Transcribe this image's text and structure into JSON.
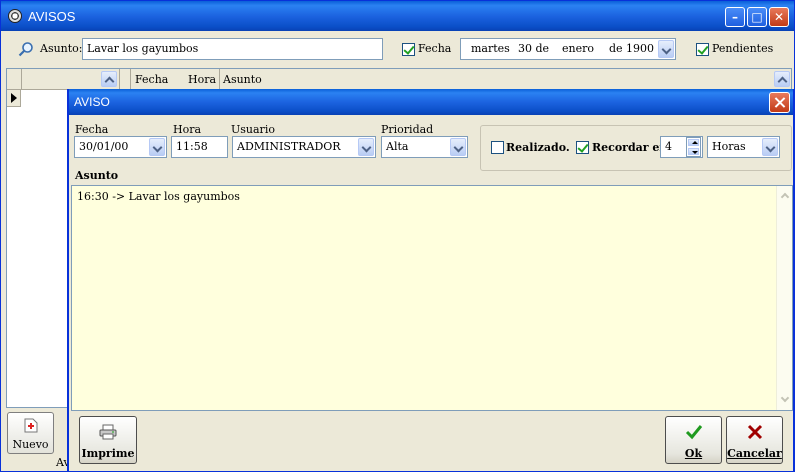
{
  "window": {
    "title": "AVISOS"
  },
  "search": {
    "label": "Asunto:",
    "value": "Lavar los gayumbos",
    "fecha_label": "Fecha",
    "fecha_checked": true,
    "date_parts": [
      "martes",
      "30 de",
      "enero",
      "de 1900"
    ],
    "pendientes_label": "Pendientes",
    "pendientes_checked": true
  },
  "grid": {
    "columns": [
      "Fecha",
      "Hora",
      "Asunto"
    ],
    "footer_fragment": "Av"
  },
  "left_toolbar": {
    "nuevo_label": "Nuevo"
  },
  "dialog": {
    "title": "AVISO",
    "fields": {
      "fecha_label": "Fecha",
      "fecha_value": "30/01/00",
      "hora_label": "Hora",
      "hora_value": "11:58",
      "usuario_label": "Usuario",
      "usuario_value": "ADMINISTRADOR",
      "prioridad_label": "Prioridad",
      "prioridad_value": "Alta"
    },
    "options": {
      "realizado_label": "Realizado.",
      "realizado_checked": false,
      "recordar_label": "Recordar en",
      "recordar_checked": true,
      "recordar_value": "4",
      "unidad_value": "Horas"
    },
    "asunto_label": "Asunto",
    "asunto_text": "16:30 -> Lavar los gayumbos",
    "buttons": {
      "imprime": "Imprime",
      "ok": "Ok",
      "cancelar": "Cancelar"
    }
  },
  "colors": {
    "titlebar": "#1c63e0",
    "memo_bg": "#ffffdd",
    "face": "#ece9d8",
    "ok_green": "#1f9a1f",
    "cancel_red": "#a00000"
  }
}
